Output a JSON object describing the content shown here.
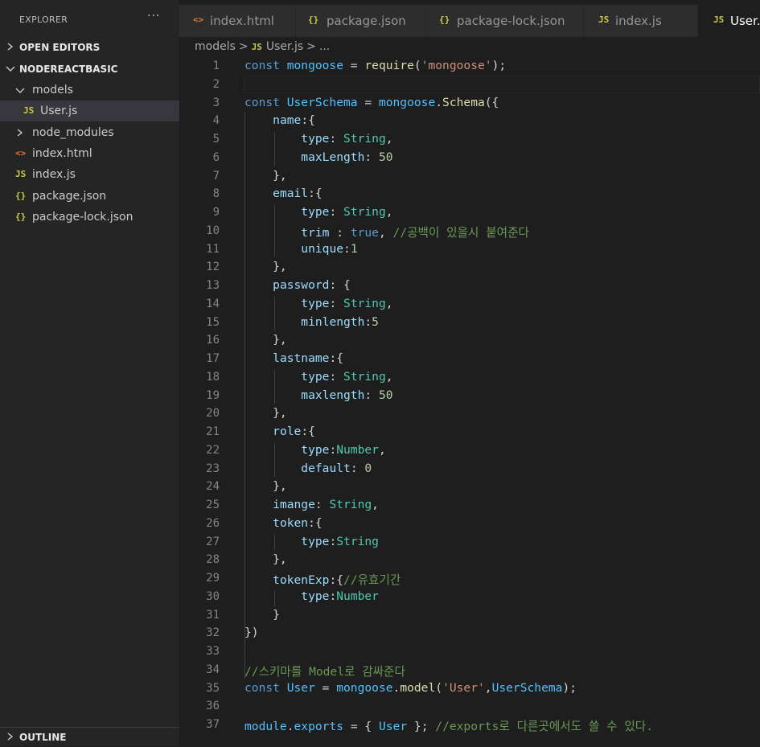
{
  "sidebar": {
    "title": "EXPLORER",
    "more": "···",
    "open_editors": "OPEN EDITORS",
    "project": "NODEREACTBASIC",
    "outline": "OUTLINE",
    "tree": [
      {
        "label": "models",
        "icon": "folder-open"
      },
      {
        "label": "User.js",
        "icon": "js-file",
        "badge": "JS"
      },
      {
        "label": "node_modules",
        "icon": "folder-closed"
      },
      {
        "label": "index.html",
        "icon": "html-file",
        "badge": "<>"
      },
      {
        "label": "index.js",
        "icon": "js-file",
        "badge": "JS"
      },
      {
        "label": "package.json",
        "icon": "json-file",
        "badge": "{}"
      },
      {
        "label": "package-lock.json",
        "icon": "json-file",
        "badge": "{}"
      }
    ]
  },
  "tabs": [
    {
      "label": "index.html",
      "badge": "<>"
    },
    {
      "label": "package.json",
      "badge": "{}"
    },
    {
      "label": "package-lock.json",
      "badge": "{}"
    },
    {
      "label": "index.js",
      "badge": "JS"
    },
    {
      "label": "User.js",
      "badge": "JS",
      "active": true
    }
  ],
  "breadcrumb": {
    "folder": "models",
    "badge": "JS",
    "file": "User.js",
    "more": "..."
  },
  "colors": {
    "js_icon": "#cbcb41",
    "html_icon": "#e37933",
    "json_icon": "#cbcb41",
    "background": "#1e1e1e"
  },
  "code": {
    "line_numbers": [
      "1",
      "2",
      "3",
      "4",
      "5",
      "6",
      "7",
      "8",
      "9",
      "10",
      "11",
      "12",
      "13",
      "14",
      "15",
      "16",
      "17",
      "18",
      "19",
      "20",
      "21",
      "22",
      "23",
      "24",
      "25",
      "26",
      "27",
      "28",
      "29",
      "30",
      "31",
      "32",
      "33",
      "34",
      "35",
      "36",
      "37"
    ],
    "lines": [
      [
        [
          "kw",
          "const "
        ],
        [
          "var",
          "mongoose"
        ],
        [
          "pun",
          " = "
        ],
        [
          "fn",
          "require"
        ],
        [
          "pun",
          "("
        ],
        [
          "str",
          "'mongoose'"
        ],
        [
          "pun",
          ");"
        ]
      ],
      [],
      [
        [
          "kw",
          "const "
        ],
        [
          "var",
          "UserSchema"
        ],
        [
          "pun",
          " = "
        ],
        [
          "var",
          "mongoose"
        ],
        [
          "pun",
          "."
        ],
        [
          "fn",
          "Schema"
        ],
        [
          "pun",
          "({"
        ]
      ],
      [
        [
          "pun",
          "    "
        ],
        [
          "prop",
          "name"
        ],
        [
          "pun",
          ":{"
        ]
      ],
      [
        [
          "pun",
          "        "
        ],
        [
          "prop",
          "type"
        ],
        [
          "pun",
          ": "
        ],
        [
          "cls",
          "String"
        ],
        [
          "pun",
          ","
        ]
      ],
      [
        [
          "pun",
          "        "
        ],
        [
          "prop",
          "maxLength"
        ],
        [
          "pun",
          ": "
        ],
        [
          "num",
          "50"
        ]
      ],
      [
        [
          "pun",
          "    },"
        ]
      ],
      [
        [
          "pun",
          "    "
        ],
        [
          "prop",
          "email"
        ],
        [
          "pun",
          ":{"
        ]
      ],
      [
        [
          "pun",
          "        "
        ],
        [
          "prop",
          "type"
        ],
        [
          "pun",
          ": "
        ],
        [
          "cls",
          "String"
        ],
        [
          "pun",
          ","
        ]
      ],
      [
        [
          "pun",
          "        "
        ],
        [
          "prop",
          "trim"
        ],
        [
          "pun",
          " : "
        ],
        [
          "kw",
          "true"
        ],
        [
          "pun",
          ", "
        ],
        [
          "cmt",
          "//공백이 있을시 붙여준다"
        ]
      ],
      [
        [
          "pun",
          "        "
        ],
        [
          "prop",
          "unique"
        ],
        [
          "pun",
          ":"
        ],
        [
          "num",
          "1"
        ]
      ],
      [
        [
          "pun",
          "    },"
        ]
      ],
      [
        [
          "pun",
          "    "
        ],
        [
          "prop",
          "password"
        ],
        [
          "pun",
          ": {"
        ]
      ],
      [
        [
          "pun",
          "        "
        ],
        [
          "prop",
          "type"
        ],
        [
          "pun",
          ": "
        ],
        [
          "cls",
          "String"
        ],
        [
          "pun",
          ","
        ]
      ],
      [
        [
          "pun",
          "        "
        ],
        [
          "prop",
          "minlength"
        ],
        [
          "pun",
          ":"
        ],
        [
          "num",
          "5"
        ]
      ],
      [
        [
          "pun",
          "    },"
        ]
      ],
      [
        [
          "pun",
          "    "
        ],
        [
          "prop",
          "lastname"
        ],
        [
          "pun",
          ":{"
        ]
      ],
      [
        [
          "pun",
          "        "
        ],
        [
          "prop",
          "type"
        ],
        [
          "pun",
          ": "
        ],
        [
          "cls",
          "String"
        ],
        [
          "pun",
          ","
        ]
      ],
      [
        [
          "pun",
          "        "
        ],
        [
          "prop",
          "maxlength"
        ],
        [
          "pun",
          ": "
        ],
        [
          "num",
          "50"
        ]
      ],
      [
        [
          "pun",
          "    },"
        ]
      ],
      [
        [
          "pun",
          "    "
        ],
        [
          "prop",
          "role"
        ],
        [
          "pun",
          ":{"
        ]
      ],
      [
        [
          "pun",
          "        "
        ],
        [
          "prop",
          "type"
        ],
        [
          "pun",
          ":"
        ],
        [
          "cls",
          "Number"
        ],
        [
          "pun",
          ","
        ]
      ],
      [
        [
          "pun",
          "        "
        ],
        [
          "prop",
          "default"
        ],
        [
          "pun",
          ": "
        ],
        [
          "num",
          "0"
        ]
      ],
      [
        [
          "pun",
          "    },"
        ]
      ],
      [
        [
          "pun",
          "    "
        ],
        [
          "prop",
          "imange"
        ],
        [
          "pun",
          ": "
        ],
        [
          "cls",
          "String"
        ],
        [
          "pun",
          ","
        ]
      ],
      [
        [
          "pun",
          "    "
        ],
        [
          "prop",
          "token"
        ],
        [
          "pun",
          ":{"
        ]
      ],
      [
        [
          "pun",
          "        "
        ],
        [
          "prop",
          "type"
        ],
        [
          "pun",
          ":"
        ],
        [
          "cls",
          "String"
        ]
      ],
      [
        [
          "pun",
          "    },"
        ]
      ],
      [
        [
          "pun",
          "    "
        ],
        [
          "prop",
          "tokenExp"
        ],
        [
          "pun",
          ":{"
        ],
        [
          "cmt",
          "//유효기간"
        ]
      ],
      [
        [
          "pun",
          "        "
        ],
        [
          "prop",
          "type"
        ],
        [
          "pun",
          ":"
        ],
        [
          "cls",
          "Number"
        ]
      ],
      [
        [
          "pun",
          "    }"
        ]
      ],
      [
        [
          "pun",
          "})"
        ]
      ],
      [],
      [
        [
          "cmt",
          "//스키마를 Model로 감싸준다"
        ]
      ],
      [
        [
          "kw",
          "const "
        ],
        [
          "var",
          "User"
        ],
        [
          "pun",
          " = "
        ],
        [
          "var",
          "mongoose"
        ],
        [
          "pun",
          "."
        ],
        [
          "fn",
          "model"
        ],
        [
          "pun",
          "("
        ],
        [
          "str",
          "'User'"
        ],
        [
          "pun",
          ","
        ],
        [
          "var",
          "UserSchema"
        ],
        [
          "pun",
          ");"
        ]
      ],
      [],
      [
        [
          "var",
          "module"
        ],
        [
          "pun",
          "."
        ],
        [
          "var",
          "exports"
        ],
        [
          "pun",
          " = { "
        ],
        [
          "var",
          "User"
        ],
        [
          "pun",
          " }; "
        ],
        [
          "cmt",
          "//exports로 다른곳에서도 쓸 수 있다."
        ]
      ]
    ]
  }
}
